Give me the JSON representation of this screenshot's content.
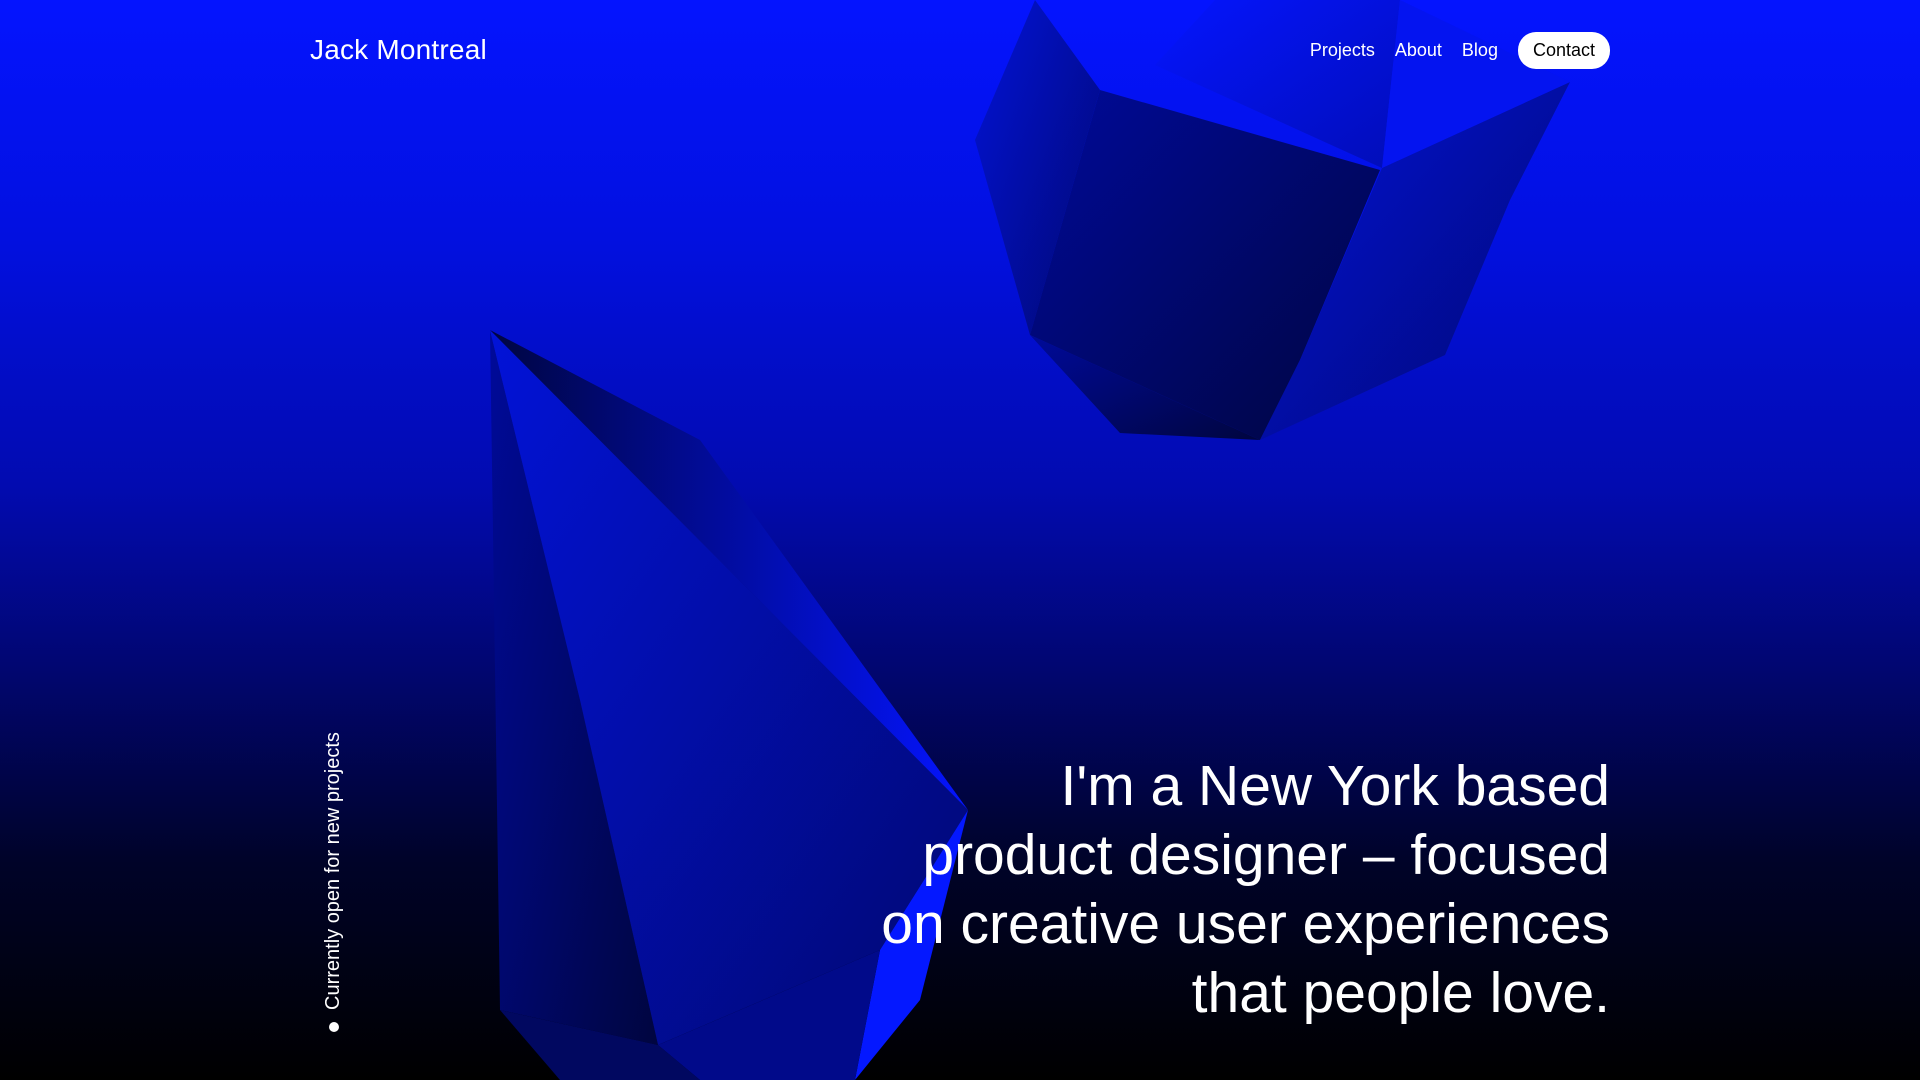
{
  "header": {
    "logo": "Jack Montreal",
    "nav": {
      "projects": "Projects",
      "about": "About",
      "blog": "Blog",
      "contact": "Contact"
    }
  },
  "status": {
    "text": "Currently open for new projects"
  },
  "hero": {
    "lines": [
      "I'm a New York based",
      "product designer – focused",
      "on creative user experiences",
      "that people love."
    ]
  },
  "colors": {
    "accent_blue": "#0414ff",
    "background_bottom": "#000000",
    "text": "#ffffff",
    "button_bg": "#ffffff",
    "button_text": "#000000"
  }
}
